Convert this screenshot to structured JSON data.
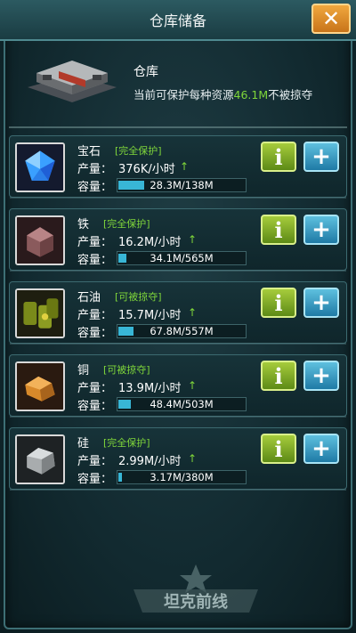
{
  "window": {
    "title": "仓库储备"
  },
  "header": {
    "name": "仓库",
    "desc_prefix": "当前可保护每种资源",
    "desc_amount": "46.1M",
    "desc_suffix": "不被掠夺"
  },
  "labels": {
    "production": "产量：",
    "capacity": "容量：",
    "info_button": "i",
    "add_button": "+"
  },
  "resources": [
    {
      "name": "宝石",
      "status": "[完全保护]",
      "production": "376K/小时",
      "capacity_text": "28.3M/138M",
      "fill": 0.205,
      "icon": "gem-icon"
    },
    {
      "name": "铁",
      "status": "[完全保护]",
      "production": "16.2M/小时",
      "capacity_text": "34.1M/565M",
      "fill": 0.06,
      "icon": "iron-icon"
    },
    {
      "name": "石油",
      "status": "[可被掠夺]",
      "production": "15.7M/小时",
      "capacity_text": "67.8M/557M",
      "fill": 0.12,
      "icon": "oil-barrels-icon"
    },
    {
      "name": "铜",
      "status": "[可被掠夺]",
      "production": "13.9M/小时",
      "capacity_text": "48.4M/503M",
      "fill": 0.096,
      "icon": "copper-icon"
    },
    {
      "name": "硅",
      "status": "[完全保护]",
      "production": "2.99M/小时",
      "capacity_text": "3.17M/380M",
      "fill": 0.008,
      "icon": "silicon-icon"
    }
  ],
  "logo": {
    "text": "坦克前线"
  },
  "colors": {
    "status_green": "#7fd63a",
    "bar_fill": "#38b6d6",
    "close_orange": "#e08c2a"
  }
}
